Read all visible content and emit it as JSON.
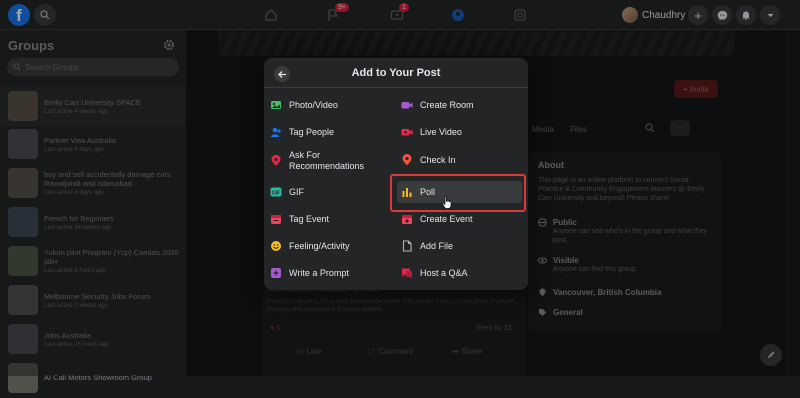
{
  "topbar": {
    "notifications_badge": "9+",
    "video_badge": "1",
    "profile_name": "Chaudhry"
  },
  "sidebar": {
    "title": "Groups",
    "search_placeholder": "Search Groups",
    "groups": [
      {
        "name": "Emily Carr University SPACE",
        "time": "Last active 4 weeks ago"
      },
      {
        "name": "Partner Visa Australia",
        "time": "Last active 4 days ago"
      },
      {
        "name": "buy and sell accidentally damage cars Rawalpindi and Islamabad",
        "time": "Last active 4 days ago"
      },
      {
        "name": "French for Beginners",
        "time": "Last active 34 weeks ago"
      },
      {
        "name": "Yukon pilot Program (Ycp) Canada 2020 job+",
        "time": "Last active 6 hours ago"
      },
      {
        "name": "Melbourne Security Jobs Forum",
        "time": "Last active 2 weeks ago"
      },
      {
        "name": "Jobs Australia",
        "time": "Last active 15 hours ago"
      },
      {
        "name": "AI Call Motors Showroom Group",
        "time": ""
      }
    ]
  },
  "group_page": {
    "invite_label": "+ Invite",
    "tabs": [
      "Media",
      "Files"
    ],
    "more_label": "···",
    "about": {
      "title": "About",
      "description": "This page is an online platform to connect Social Practice & Community Engagement learners @ Emily Carr University and beyond! Please share!",
      "public_title": "Public",
      "public_desc": "Anyone can see who's in the group and what they post.",
      "visible_title": "Visible",
      "visible_desc": "Anyone can find this group.",
      "location": "Vancouver, British Columbia",
      "category": "General"
    },
    "post": {
      "headline": "This content isn't available right now",
      "body": "When this happens, it's usually because the owner only shared it with a small group of people, changed who can see it or it's been deleted.",
      "reactions": "1",
      "seen_by": "Seen by 32",
      "like_label": "Like",
      "comment_label": "Comment",
      "share_label": "Share"
    }
  },
  "modal": {
    "title": "Add to Your Post",
    "left_options": [
      {
        "label": "Photo/Video",
        "icon": "photo-video-icon",
        "color": "#45bd62"
      },
      {
        "label": "Tag People",
        "icon": "tag-people-icon",
        "color": "#1877f2"
      },
      {
        "label": "Ask For Recommendations",
        "icon": "recommendations-icon",
        "color": "#e42645"
      },
      {
        "label": "GIF",
        "icon": "gif-icon",
        "color": "#2abba7"
      },
      {
        "label": "Tag Event",
        "icon": "tag-event-icon",
        "color": "#f3425f"
      },
      {
        "label": "Feeling/Activity",
        "icon": "feeling-icon",
        "color": "#f7b928"
      },
      {
        "label": "Write a Prompt",
        "icon": "prompt-icon",
        "color": "#a55ad0"
      }
    ],
    "right_options": [
      {
        "label": "Create Room",
        "icon": "create-room-icon",
        "color": "#a55ad0"
      },
      {
        "label": "Live Video",
        "icon": "live-video-icon",
        "color": "#f02849"
      },
      {
        "label": "Check In",
        "icon": "check-in-icon",
        "color": "#f5533d"
      },
      {
        "label": "Poll",
        "icon": "poll-icon",
        "color": "#f7b928"
      },
      {
        "label": "Create Event",
        "icon": "create-event-icon",
        "color": "#f3425f"
      },
      {
        "label": "Add File",
        "icon": "add-file-icon",
        "color": "#b0b3b8"
      },
      {
        "label": "Host a Q&A",
        "icon": "qa-icon",
        "color": "#e42645"
      }
    ]
  }
}
